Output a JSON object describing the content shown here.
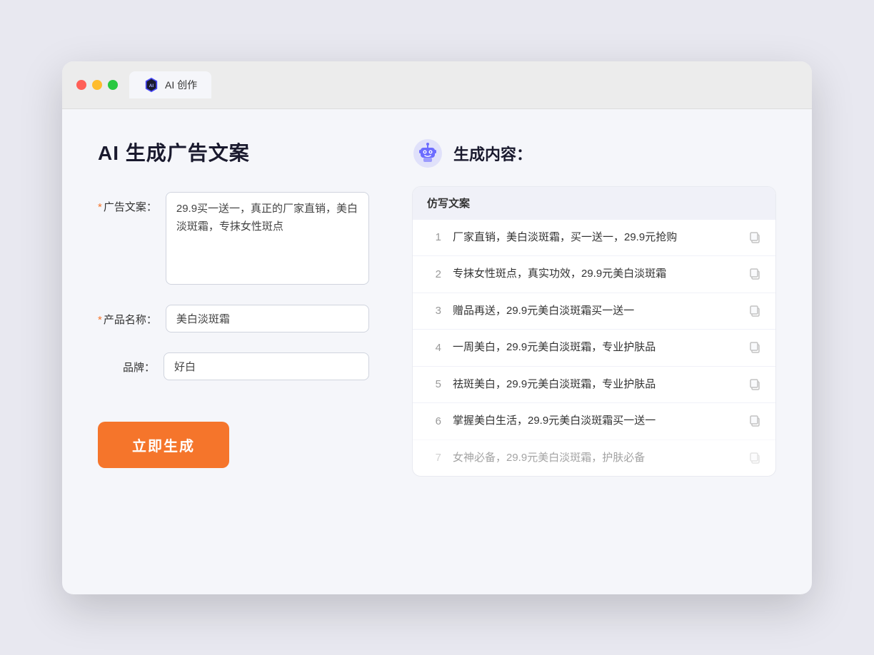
{
  "browser": {
    "tab_label": "AI 创作"
  },
  "page": {
    "title": "AI 生成广告文案"
  },
  "form": {
    "ad_copy_label": "广告文案：",
    "ad_copy_required": "*",
    "ad_copy_value": "29.9买一送一，真正的厂家直销，美白淡斑霜，专抹女性斑点",
    "product_name_label": "产品名称：",
    "product_name_required": "*",
    "product_name_value": "美白淡斑霜",
    "brand_label": "品牌：",
    "brand_value": "好白",
    "generate_button": "立即生成"
  },
  "result": {
    "header": "生成内容：",
    "column_label": "仿写文案",
    "items": [
      {
        "num": "1",
        "text": "厂家直销，美白淡斑霜，买一送一，29.9元抢购"
      },
      {
        "num": "2",
        "text": "专抹女性斑点，真实功效，29.9元美白淡斑霜"
      },
      {
        "num": "3",
        "text": "赠品再送，29.9元美白淡斑霜买一送一"
      },
      {
        "num": "4",
        "text": "一周美白，29.9元美白淡斑霜，专业护肤品"
      },
      {
        "num": "5",
        "text": "祛斑美白，29.9元美白淡斑霜，专业护肤品"
      },
      {
        "num": "6",
        "text": "掌握美白生活，29.9元美白淡斑霜买一送一"
      },
      {
        "num": "7",
        "text": "女神必备，29.9元美白淡斑霜，护肤必备"
      }
    ]
  }
}
